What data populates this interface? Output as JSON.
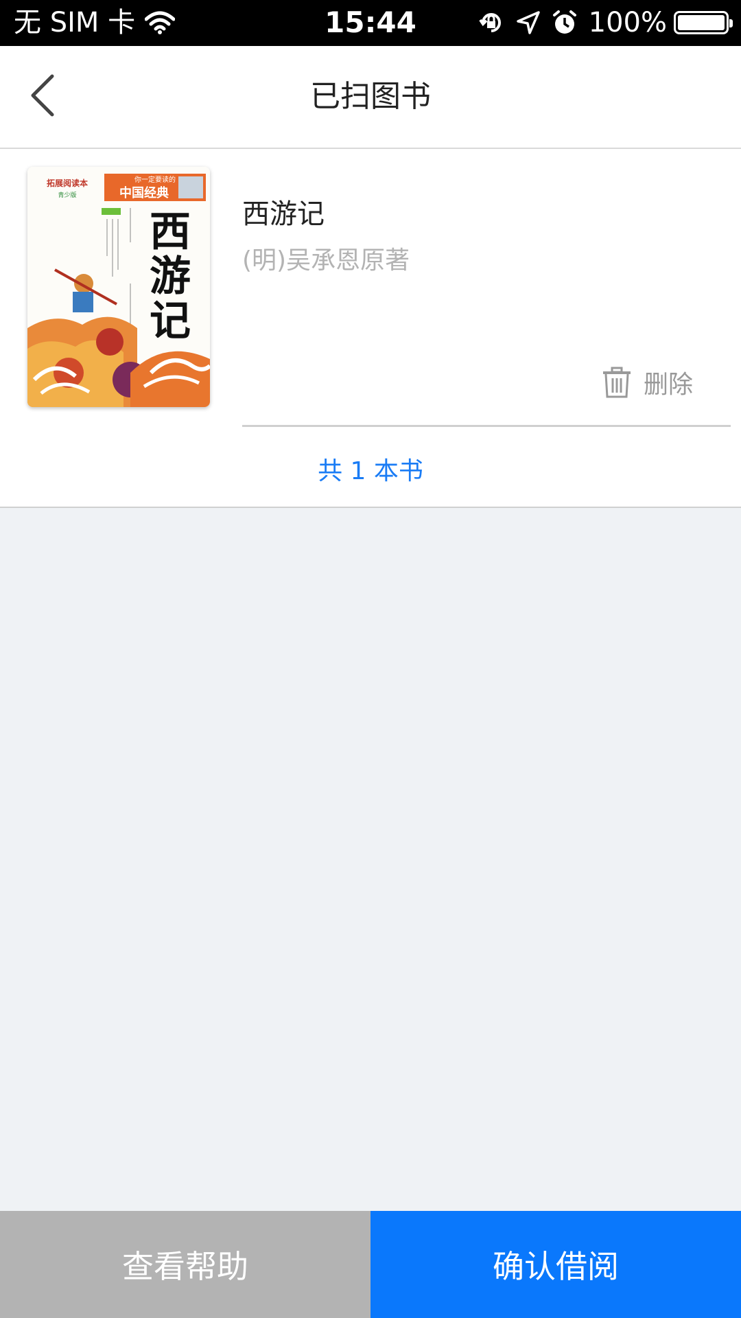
{
  "status_bar": {
    "carrier": "无 SIM 卡",
    "time": "15:44",
    "battery": "100%",
    "icons": [
      "wifi-icon",
      "orientation-lock-icon",
      "location-icon",
      "alarm-icon",
      "battery-icon"
    ]
  },
  "nav": {
    "title": "已扫图书",
    "back_icon": "chevron-left-icon"
  },
  "book": {
    "title": "西游记",
    "author": "(明)吴承恩原著",
    "delete_label": "删除",
    "cover": {
      "title": "西游记",
      "series": "中国经典",
      "banner": "你一定要读的",
      "badge": "拓展阅读本",
      "edition": "青少版"
    }
  },
  "summary": {
    "count_text": "共 1 本书"
  },
  "bottom": {
    "help_label": "查看帮助",
    "confirm_label": "确认借阅"
  },
  "colors": {
    "accent": "#0a78fc",
    "count_text": "#1a7cf5",
    "help_bg": "#b3b3b3",
    "page_bg": "#eff2f5"
  }
}
